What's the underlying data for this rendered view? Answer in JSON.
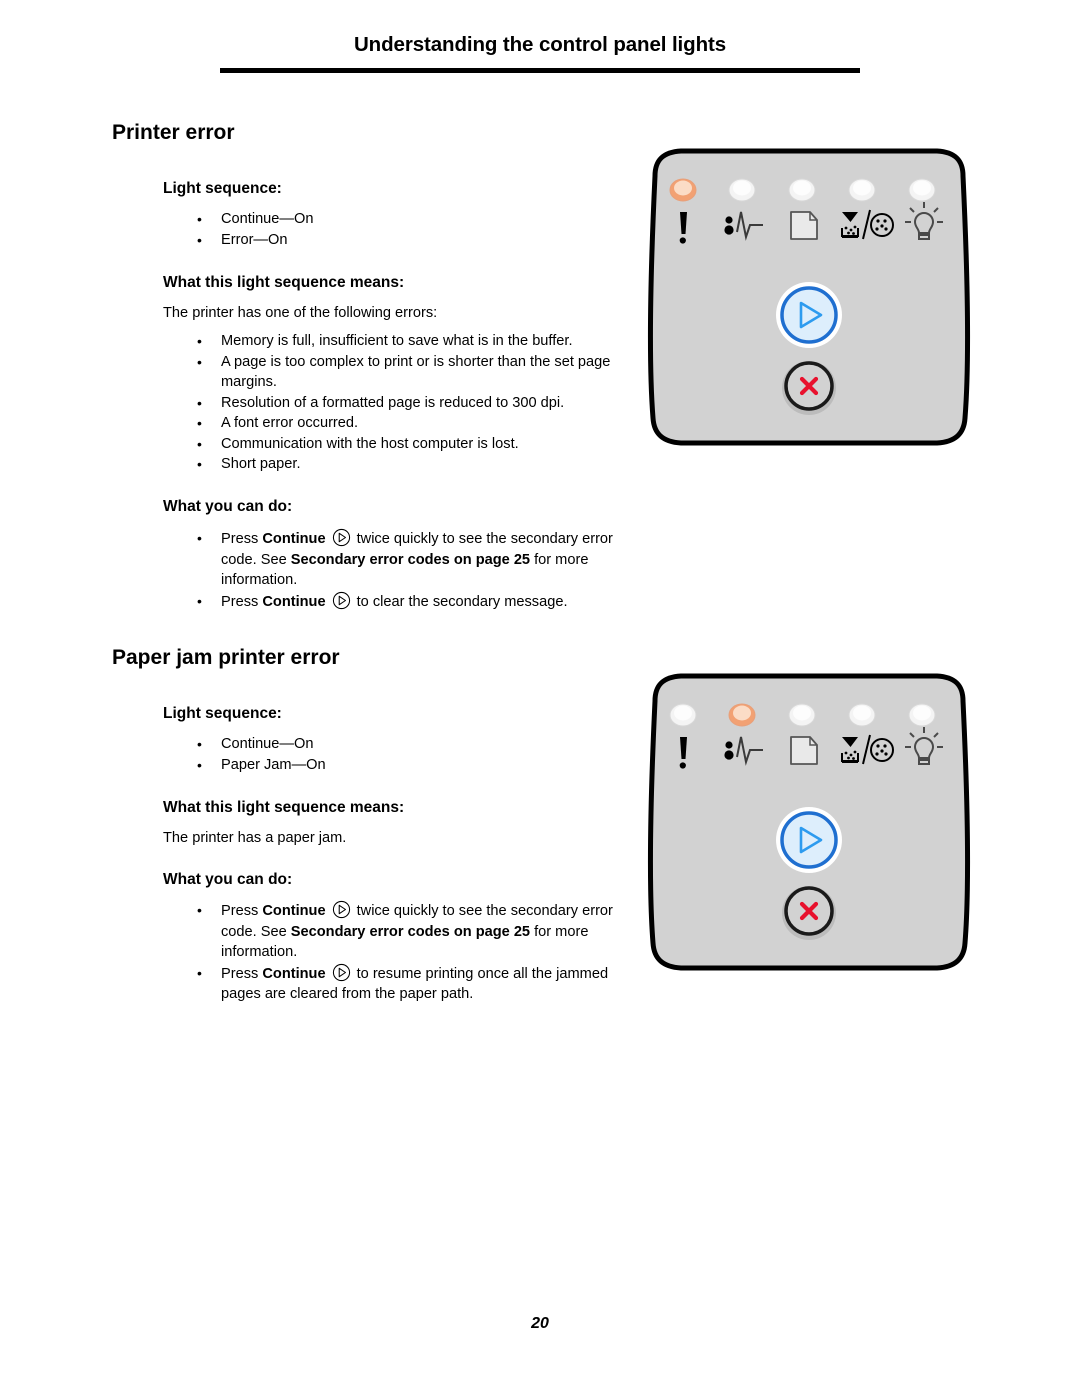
{
  "header": {
    "title": "Understanding the control panel lights"
  },
  "page_number": "20",
  "sections": [
    {
      "title": "Printer error",
      "light_sequence_heading": "Light sequence:",
      "light_sequence": [
        "Continue—On",
        "Error—On"
      ],
      "means_heading": "What this light sequence means:",
      "means_intro": "The printer has one of the following errors:",
      "means_items": [
        "Memory is full, insufficient to save what is in the buffer.",
        "A page is too complex to print or is shorter than the set page margins.",
        "Resolution of a formatted page is reduced to 300 dpi.",
        "A font error occurred.",
        "Communication with the host computer is lost.",
        "Short paper."
      ],
      "do_heading": "What you can do:",
      "do_items": [
        {
          "pre": "Press ",
          "bold1": "Continue",
          "icon": "continue-icon",
          "mid": "twice quickly to see the secondary error code. See ",
          "bold2": "Secondary error codes on page 25",
          "post": " for more information."
        },
        {
          "pre": "Press ",
          "bold1": "Continue",
          "icon": "continue-icon",
          "mid": "to clear the secondary message.",
          "bold2": "",
          "post": ""
        }
      ],
      "panel": {
        "leds": [
          {
            "name": "error-led",
            "icon": "exclamation-icon",
            "lit": true
          },
          {
            "name": "paper-jam-led",
            "icon": "paper-jam-icon",
            "lit": false
          },
          {
            "name": "load-paper-led",
            "icon": "paper-sheet-icon",
            "lit": false
          },
          {
            "name": "toner-led",
            "icon": "toner-icon",
            "lit": false
          },
          {
            "name": "ready-led",
            "icon": "light-bulb-icon",
            "lit": false
          }
        ],
        "continue_button": "continue-button",
        "cancel_button": "cancel-button"
      }
    },
    {
      "title": "Paper jam printer error",
      "light_sequence_heading": "Light sequence:",
      "light_sequence": [
        "Continue—On",
        "Paper Jam—On"
      ],
      "means_heading": "What this light sequence means:",
      "means_intro": "The printer has a paper jam.",
      "means_items": [],
      "do_heading": "What you can do:",
      "do_items": [
        {
          "pre": "Press ",
          "bold1": "Continue",
          "icon": "continue-icon",
          "mid": "twice quickly to see the secondary error code. See ",
          "bold2": "Secondary error codes on page 25",
          "post": " for more information."
        },
        {
          "pre": "Press ",
          "bold1": "Continue",
          "icon": "continue-icon",
          "mid": "to resume printing once all the jammed pages are cleared from the paper path.",
          "bold2": "",
          "post": ""
        }
      ],
      "panel": {
        "leds": [
          {
            "name": "error-led",
            "icon": "exclamation-icon",
            "lit": false
          },
          {
            "name": "paper-jam-led",
            "icon": "paper-jam-icon",
            "lit": true
          },
          {
            "name": "load-paper-led",
            "icon": "paper-sheet-icon",
            "lit": false
          },
          {
            "name": "toner-led",
            "icon": "toner-icon",
            "lit": false
          },
          {
            "name": "ready-led",
            "icon": "light-bulb-icon",
            "lit": false
          }
        ],
        "continue_button": "continue-button",
        "cancel_button": "cancel-button"
      }
    }
  ],
  "colors": {
    "led_on": "#f2a173",
    "led_on_center": "#fbdcc6",
    "led_off": "#f4f4f4",
    "panel_fill": "#d2d2d2",
    "panel_stroke": "#000000",
    "continue_ring": "#1f6fd0",
    "continue_fill": "#ddeefc",
    "continue_glyph": "#2d9bef",
    "cancel_ring": "#1a1a1a",
    "cancel_glyph": "#e8112d"
  }
}
